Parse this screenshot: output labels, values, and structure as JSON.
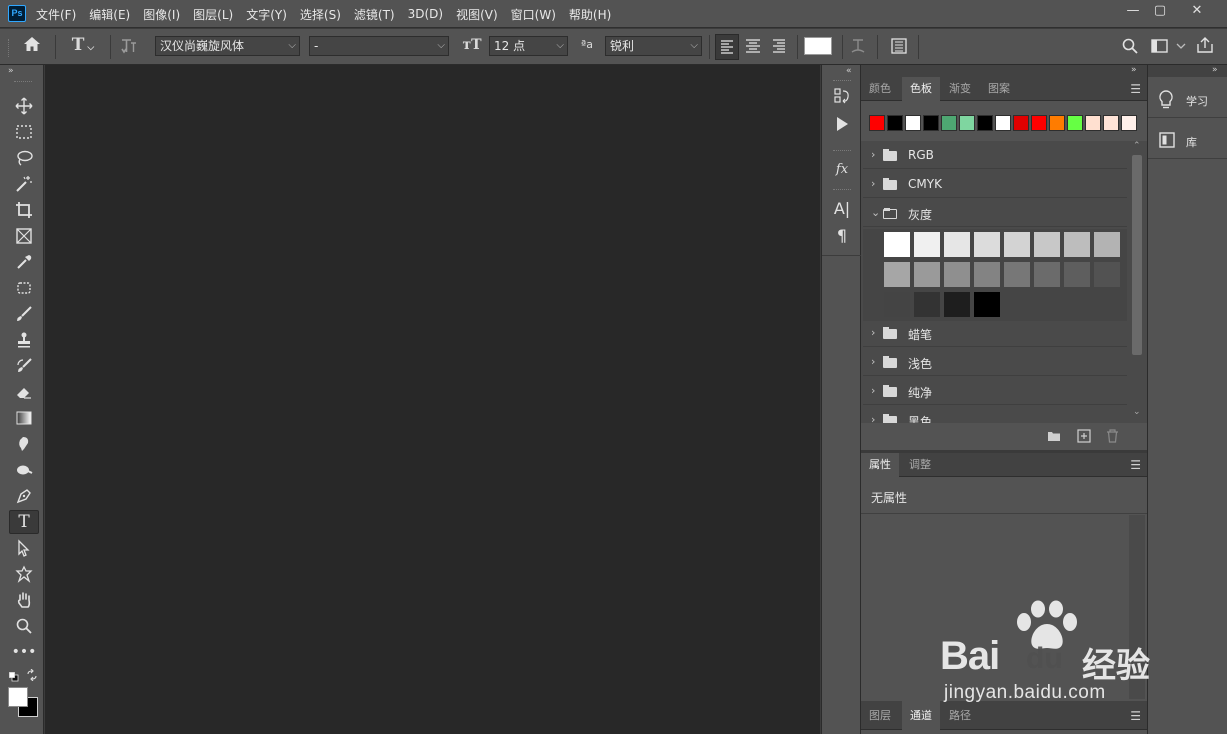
{
  "app": {
    "logo": "Ps"
  },
  "menu": [
    "文件(F)",
    "编辑(E)",
    "图像(I)",
    "图层(L)",
    "文字(Y)",
    "选择(S)",
    "滤镜(T)",
    "3D(D)",
    "视图(V)",
    "窗口(W)",
    "帮助(H)"
  ],
  "window_controls": {
    "minimize": "—",
    "restore": "▢",
    "close": "✕"
  },
  "options": {
    "font_family": "汉仪尚巍旋风体",
    "font_style": "-",
    "font_size": "12 点",
    "antialias": "锐利"
  },
  "swatches_panel": {
    "tabs": [
      "颜色",
      "色板",
      "渐变",
      "图案"
    ],
    "active_tab": "色板",
    "recent_colors": [
      "#ff0000",
      "#000000",
      "#ffffff",
      "#000000",
      "#4ea772",
      "#7fd6a0",
      "#000000",
      "#ffffff",
      "#e00000",
      "#ff0000",
      "#ff7c00",
      "#66ff44",
      "#ffe0d0",
      "#ffe4d8",
      "#fff0ea"
    ],
    "groups": [
      {
        "name": "RGB",
        "expanded": false
      },
      {
        "name": "CMYK",
        "expanded": false
      },
      {
        "name": "灰度",
        "expanded": true
      },
      {
        "name": "蜡笔",
        "expanded": false
      },
      {
        "name": "浅色",
        "expanded": false
      },
      {
        "name": "纯净",
        "expanded": false
      },
      {
        "name": "黑色",
        "expanded": false
      }
    ],
    "gray_swatches": [
      "#ffffff",
      "#f0f0f0",
      "#e6e6e6",
      "#dcdcdc",
      "#d3d3d3",
      "#c8c8c8",
      "#bdbdbd",
      "#b3b3b3",
      "#a6a6a6",
      "#9a9a9a",
      "#8f8f8f",
      "#838383",
      "#777777",
      "#6b6b6b",
      "#5e5e5e",
      "#525252",
      "#444444",
      "#333333",
      "#1e1e1e",
      "#000000"
    ]
  },
  "properties_panel": {
    "tabs": [
      "属性",
      "调整"
    ],
    "active_tab": "属性",
    "content": "无属性"
  },
  "bottom_tabs": {
    "tabs": [
      "图层",
      "通道",
      "路径"
    ],
    "active_tab": "通道"
  },
  "right_column": {
    "learn": "学习",
    "library": "库"
  },
  "watermark": {
    "brand": "Bai",
    "brand2": "du",
    "suffix": "经验",
    "url": "jingyan.baidu.com"
  }
}
